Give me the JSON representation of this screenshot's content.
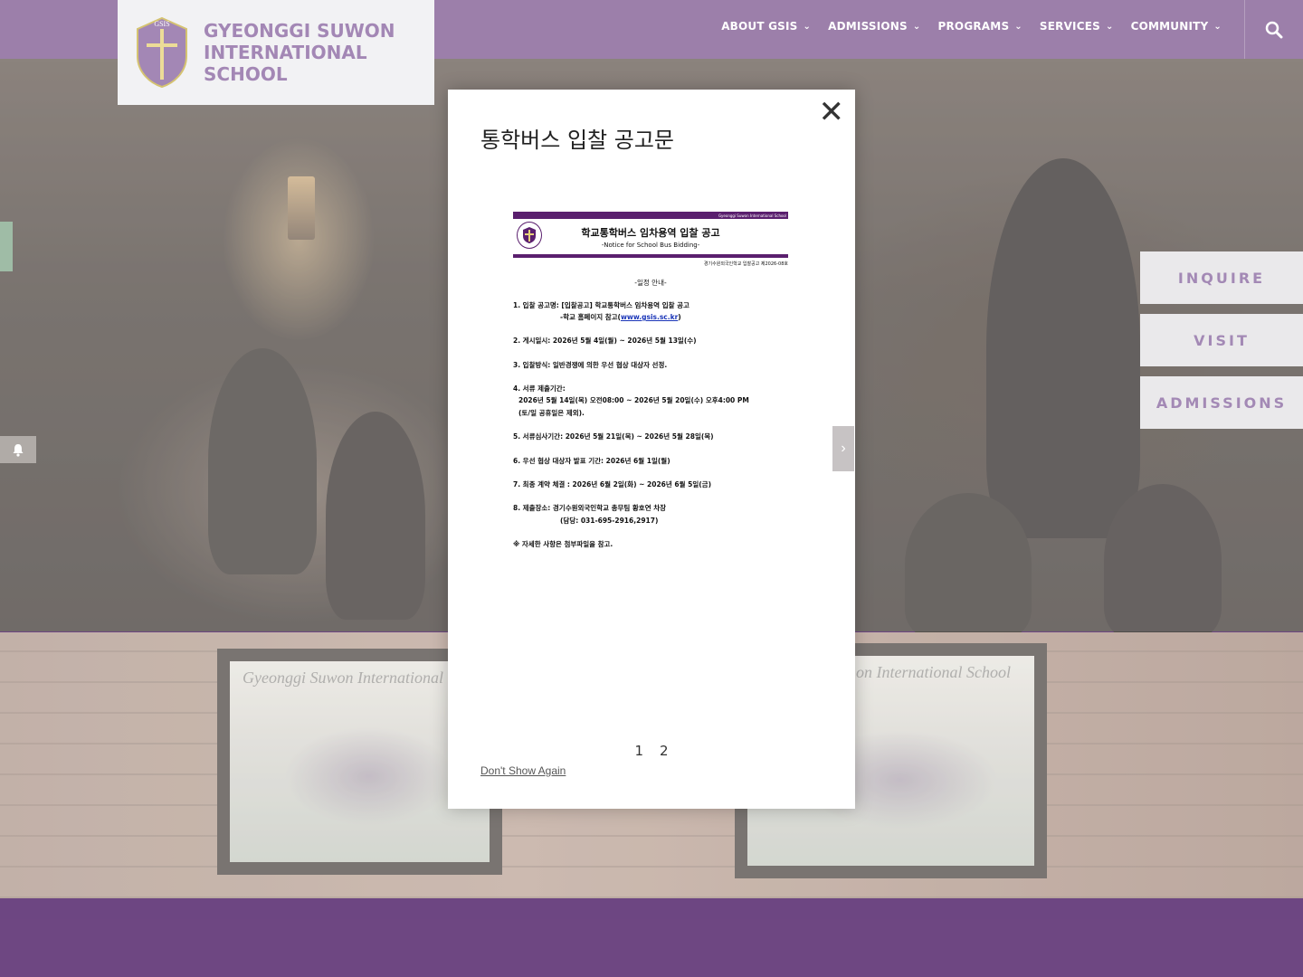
{
  "header": {
    "school_name": "GYEONGGI SUWON INTERNATIONAL SCHOOL",
    "crest_letters": "GSIS",
    "nav": [
      {
        "label": "ABOUT GSIS"
      },
      {
        "label": "ADMISSIONS"
      },
      {
        "label": "PROGRAMS"
      },
      {
        "label": "SERVICES"
      },
      {
        "label": "COMMUNITY"
      }
    ]
  },
  "side_buttons": {
    "inquire": "INQUIRE",
    "visit": "VISIT",
    "admissions": "ADMISSIONS"
  },
  "strip": {
    "frame_caption_left": "Gyeonggi Suwon International",
    "frame_caption_right": "on International School"
  },
  "modal": {
    "title": "통학버스 입찰 공고문",
    "close": "✕",
    "notice": {
      "header_small": "Gyeonggi Suwon International School",
      "title": "학교통학버스 임차용역 입찰 공고",
      "subtitle": "-Notice for School Bus Bidding-",
      "doc_no": "경기수원외국인학교 입찰공고 제2026-08호",
      "schedule_heading": "-일정 안내-",
      "item1": "1. 입찰 공고명: [입찰공고] 학교통학버스 임차용역 입찰 공고",
      "item1b_prefix": "-학교 홈페이지 참고(",
      "item1b_link": "www.gsis.sc.kr",
      "item1b_suffix": ")",
      "item2": "2. 게시일시: 2026년 5월 4일(월) ~ 2026년 5월 13일(수)",
      "item3": "3. 입찰방식: 일반경쟁에 의한 우선 협상 대상자 선정.",
      "item4": "4. 서류 제출기간:",
      "item4b": "2026년 5월 14일(목) 오전08:00 ~ 2026년 5월 20일(수) 오후4:00 PM",
      "item4c": "(토/일 공휴일은 제외).",
      "item5": "5. 서류심사기간: 2026년 5월 21일(목) ~ 2026년 5월 28일(목)",
      "item6": "6. 우선 협상 대상자 발표 기간: 2026년 6월 1일(월)",
      "item7": "7. 최종 계약 체결 : 2026년 6월 2일(화) ~ 2026년 6월 5일(금)",
      "item8": "8. 제출장소: 경기수원외국인학교 총무팀 황호연 차장",
      "item8b": "(담당: 031-695-2916,2917)",
      "note": "※ 자세한 사항은 첨부파일을 참고."
    },
    "pages": [
      "1",
      "2"
    ],
    "dont_show_again": "Don't Show Again"
  },
  "icons": {
    "search": "search-icon",
    "bell": "bell-icon",
    "next": "›"
  },
  "colors": {
    "header_bg": "#805b93",
    "brand_purple": "#8a66a0",
    "footer_bg": "#45135f"
  }
}
